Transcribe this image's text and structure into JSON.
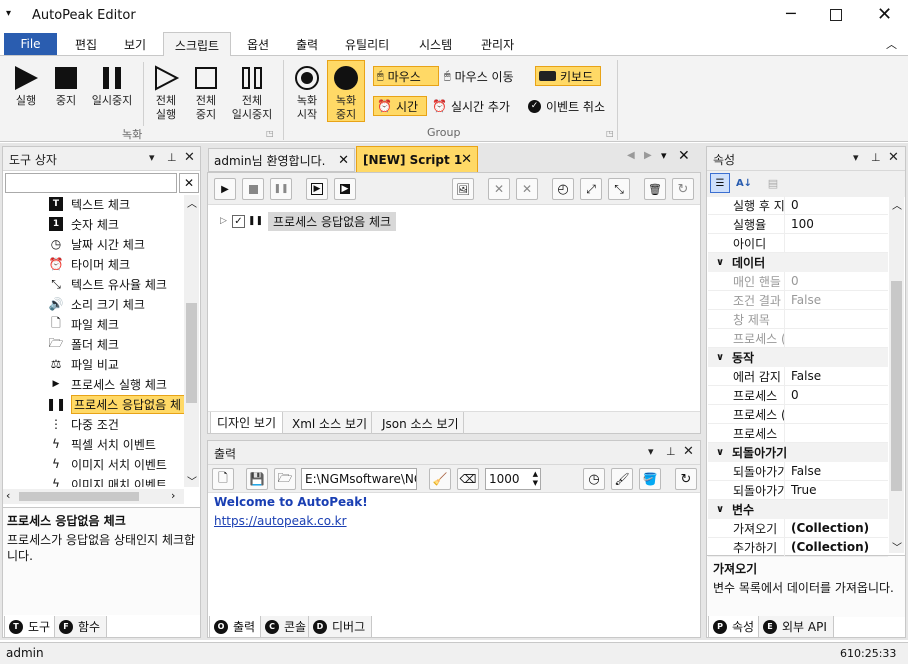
{
  "window": {
    "title": "AutoPeak Editor",
    "status_user": "admin",
    "status_time": "610:25:33"
  },
  "menu": {
    "file": "File",
    "tabs": [
      "편집",
      "보기",
      "스크립트",
      "옵션",
      "출력",
      "유틸리티",
      "시스템",
      "관리자"
    ]
  },
  "ribbon": {
    "run": "실행",
    "stop": "중지",
    "pause": "일시중지",
    "all_run": [
      "전체",
      "실행"
    ],
    "all_stop": [
      "전체",
      "중지"
    ],
    "all_pause": [
      "전체",
      "일시중지"
    ],
    "rec_start": [
      "녹화",
      "시작"
    ],
    "rec_stop": [
      "녹화",
      "중지"
    ],
    "group_rec": "녹화",
    "group_group": "Group",
    "mouse": "마우스",
    "mouse_move": "마우스 이동",
    "keyboard": "키보드",
    "time": "시간",
    "realtime_add": "실시간 추가",
    "event_cancel": "이벤트 취소"
  },
  "toolbox": {
    "title": "도구 상자",
    "items": [
      "텍스트 체크",
      "숫자 체크",
      "날짜 시간 체크",
      "타이머 체크",
      "텍스트 유사율 체크",
      "소리 크기 체크",
      "파일 체크",
      "폴더 체크",
      "파일 비교",
      "프로세스 실행 체크",
      "프로세스 응답없음 체",
      "다중 조건",
      "픽셀 서치 이벤트",
      "이미지 서치 이벤트",
      "이미지 매치 이벤트"
    ],
    "desc_title": "프로세스 응답없음 체크",
    "desc_text": "프로세스가 응답없음 상태인지 체크합니다.",
    "tab_tool": "도구",
    "tab_func": "함수"
  },
  "editor": {
    "tab1": "admin님 환영합니다.",
    "tab2": "[NEW] Script 1",
    "node": "프로세스 응답없음 체크",
    "view_design": "디자인 보기",
    "view_xml": "Xml 소스 보기",
    "view_json": "Json 소스 보기"
  },
  "output": {
    "title": "출력",
    "path": "E:\\NGMsoftware\\NG",
    "count": "1000",
    "line1": "Welcome to AutoPeak!",
    "line2": "https://autopeak.co.kr",
    "tab_out": "출력",
    "tab_console": "콘솔",
    "tab_debug": "디버그"
  },
  "props": {
    "title": "속성",
    "rows": [
      {
        "k": "실행 후 지",
        "v": "0"
      },
      {
        "k": "실행율",
        "v": "100"
      },
      {
        "k": "아이디",
        "v": ""
      },
      {
        "cat": "데이터"
      },
      {
        "k": "매인 핸들",
        "v": "0",
        "dim": true
      },
      {
        "k": "조건 결과",
        "v": "False",
        "dim": true
      },
      {
        "k": "창 제목",
        "v": "",
        "dim": true
      },
      {
        "k": "프로세스 (",
        "v": "",
        "dim": true
      },
      {
        "cat": "동작"
      },
      {
        "k": "에러 감지",
        "v": "False"
      },
      {
        "k": "프로세스 ",
        "v": "0"
      },
      {
        "k": "프로세스 (",
        "v": ""
      },
      {
        "k": "프로세스 ",
        "v": ""
      },
      {
        "cat": "되돌아가기"
      },
      {
        "k": "되돌아가기",
        "v": "False"
      },
      {
        "k": "되돌아가기",
        "v": "True"
      },
      {
        "cat": "변수"
      },
      {
        "k": "가져오기",
        "v": "(Collection)",
        "bold": true
      },
      {
        "k": "추가하기",
        "v": "(Collection)",
        "bold": true
      }
    ],
    "desc_title": "가져오기",
    "desc_text": "변수 목록에서 데이터를 가져옵니다.",
    "tab_props": "속성",
    "tab_api": "외부 API"
  },
  "colors": {
    "accent": "#2a5db0",
    "highlight": "#ffd966",
    "highlight_border": "#e8a317"
  }
}
